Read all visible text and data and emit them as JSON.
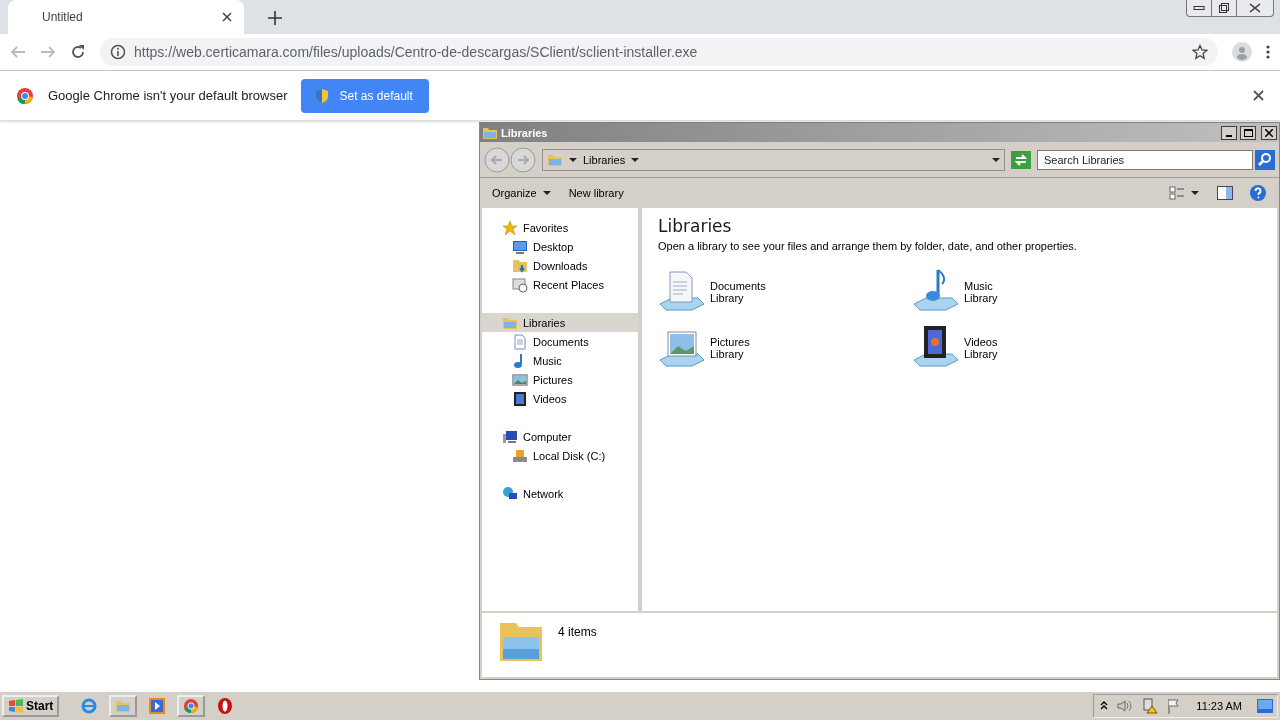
{
  "browser": {
    "tab": {
      "title": "Untitled"
    },
    "url": "https://web.certicamara.com/files/uploads/Centro-de-descargas/SClient/sclient-installer.exe",
    "infobar": {
      "message": "Google Chrome isn't your default browser",
      "button": "Set as default"
    }
  },
  "explorer": {
    "title": "Libraries",
    "breadcrumb": "Libraries",
    "search": {
      "placeholder": "Search Libraries"
    },
    "toolbar": [
      {
        "label": "Organize",
        "menu": true
      },
      {
        "label": "New library",
        "menu": false
      }
    ],
    "nav": [
      {
        "label": "Favorites",
        "selected": false,
        "children": [
          {
            "label": "Desktop",
            "selected": false
          },
          {
            "label": "Downloads",
            "selected": false
          },
          {
            "label": "Recent Places",
            "selected": false
          }
        ]
      },
      {
        "label": "Libraries",
        "selected": true,
        "children": [
          {
            "label": "Documents",
            "selected": false
          },
          {
            "label": "Music",
            "selected": false
          },
          {
            "label": "Pictures",
            "selected": false
          },
          {
            "label": "Videos",
            "selected": false
          }
        ]
      },
      {
        "label": "Computer",
        "selected": false,
        "children": [
          {
            "label": "Local Disk (C:)",
            "selected": false
          }
        ]
      },
      {
        "label": "Network",
        "selected": false
      }
    ],
    "heading": "Libraries",
    "description": "Open a library to see your files and arrange them by folder, date, and other properties.",
    "libraries": [
      {
        "name": "Documents",
        "type": "Library",
        "kind": "documents"
      },
      {
        "name": "Music",
        "type": "Library",
        "kind": "music"
      },
      {
        "name": "Pictures",
        "type": "Library",
        "kind": "pictures"
      },
      {
        "name": "Videos",
        "type": "Library",
        "kind": "videos"
      }
    ],
    "status": "4 items"
  },
  "taskbar": {
    "start": "Start",
    "clock": "11:23 AM"
  }
}
